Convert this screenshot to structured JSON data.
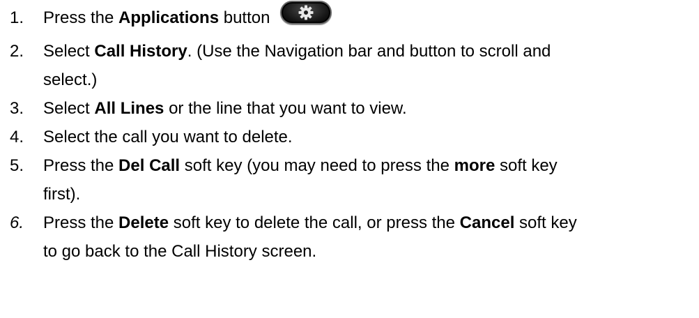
{
  "steps": [
    {
      "num": "1.",
      "pre": "Press the ",
      "bold": "Applications",
      "post": " button",
      "icon": "gear-icon"
    },
    {
      "num": "2.",
      "pre": "Select ",
      "bold": "Call History",
      "post": ". (Use the Navigation bar and button to scroll and",
      "line2": "select.)"
    },
    {
      "num": "3.",
      "pre": "Select ",
      "bold": "All Lines",
      "post": " or the line that you want to view."
    },
    {
      "num": "4.",
      "text": "Select the call you want to delete."
    },
    {
      "num": "5.",
      "pre": "Press the ",
      "bold": "Del Call",
      "mid": " soft key (you may need to press the ",
      "bold2": "more",
      "post": " soft key",
      "line2": "first)."
    },
    {
      "num": "6.",
      "pre": "Press the ",
      "bold": "Delete",
      "mid": " soft key to delete the call, or press the ",
      "bold2": "Cancel",
      "post": " soft key",
      "line2": "to go back to the Call History screen."
    }
  ],
  "colors": {
    "text": "#000000",
    "button_body": "#151515",
    "button_rim": "#6a6a6a",
    "gear": "#e6e6e6"
  }
}
